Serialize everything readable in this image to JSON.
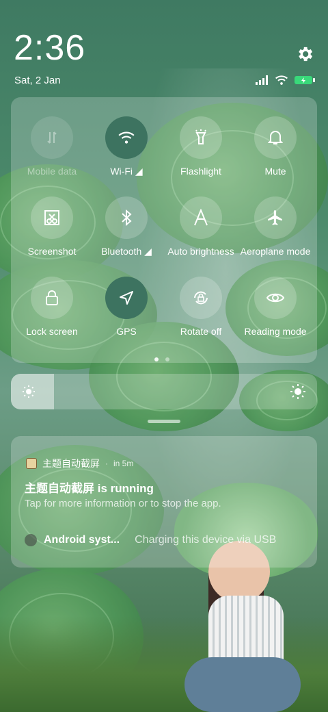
{
  "status_bar": {
    "time": "2:36",
    "date": "Sat, 2 Jan",
    "battery_color": "#39d97a"
  },
  "quick_settings": {
    "tiles": [
      {
        "label": "Mobile data",
        "icon": "mobile-data-icon",
        "state": "disabled"
      },
      {
        "label": "Wi-Fi",
        "icon": "wifi-icon",
        "state": "active"
      },
      {
        "label": "Flashlight",
        "icon": "flashlight-icon",
        "state": "off"
      },
      {
        "label": "Mute",
        "icon": "bell-icon",
        "state": "off"
      },
      {
        "label": "Screenshot",
        "icon": "screenshot-icon",
        "state": "off"
      },
      {
        "label": "Bluetooth",
        "icon": "bluetooth-icon",
        "state": "off"
      },
      {
        "label": "Auto brightness",
        "icon": "auto-brightness-icon",
        "state": "off"
      },
      {
        "label": "Aeroplane mode",
        "icon": "airplane-icon",
        "state": "off"
      },
      {
        "label": "Lock screen",
        "icon": "lock-icon",
        "state": "off"
      },
      {
        "label": "GPS",
        "icon": "location-arrow-icon",
        "state": "active"
      },
      {
        "label": "Rotate off",
        "icon": "rotate-lock-icon",
        "state": "off"
      },
      {
        "label": "Reading mode",
        "icon": "eye-icon",
        "state": "off"
      }
    ],
    "page_count": 2,
    "current_page": 1
  },
  "brightness": {
    "level": 0.14
  },
  "notifications": {
    "app_name": "主题自动截屏",
    "time_ago": "in 5m",
    "title": "主题自动截屏 is running",
    "body": "Tap for more information or to stop the app.",
    "secondary_title": "Android syst...",
    "secondary_text": "Charging this device via USB"
  },
  "colors": {
    "active_tile": "#3d7360",
    "panel": "rgba(255,255,255,0.22)"
  }
}
